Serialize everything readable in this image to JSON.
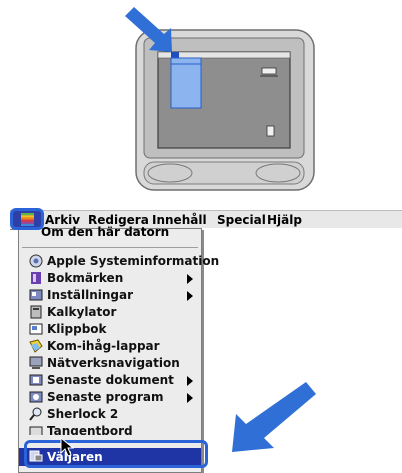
{
  "menubar": {
    "apple_menu": "Apple-menu",
    "items": [
      "Arkiv",
      "Redigera",
      "Innehåll",
      "Special",
      "Hjälp"
    ]
  },
  "apple_menu": {
    "about": "Om den här datorn",
    "items": [
      {
        "label": "Apple Systeminformation",
        "icon": "apple-system-info-icon",
        "submenu": false
      },
      {
        "label": "Bokmärken",
        "icon": "bookmarks-icon",
        "submenu": true
      },
      {
        "label": "Inställningar",
        "icon": "control-panels-icon",
        "submenu": true
      },
      {
        "label": "Kalkylator",
        "icon": "calculator-icon",
        "submenu": false
      },
      {
        "label": "Klippbok",
        "icon": "scrapbook-icon",
        "submenu": false
      },
      {
        "label": "Kom-ihåg-lappar",
        "icon": "stickies-icon",
        "submenu": false
      },
      {
        "label": "Nätverksnavigation",
        "icon": "network-browser-icon",
        "submenu": false
      },
      {
        "label": "Senaste dokument",
        "icon": "recent-documents-icon",
        "submenu": true
      },
      {
        "label": "Senaste program",
        "icon": "recent-apps-icon",
        "submenu": true
      },
      {
        "label": "Sherlock 2",
        "icon": "sherlock-icon",
        "submenu": false
      },
      {
        "label": "Tangentbord",
        "icon": "keyboard-icon",
        "submenu": false
      },
      {
        "label": "Väljaren",
        "icon": "chooser-icon",
        "submenu": false,
        "selected": true
      }
    ]
  },
  "colors": {
    "highlight_outline": "#2b63d9",
    "arrow": "#2f6fd6",
    "selection": "#1f35a6",
    "menu_bg": "#ececec"
  }
}
